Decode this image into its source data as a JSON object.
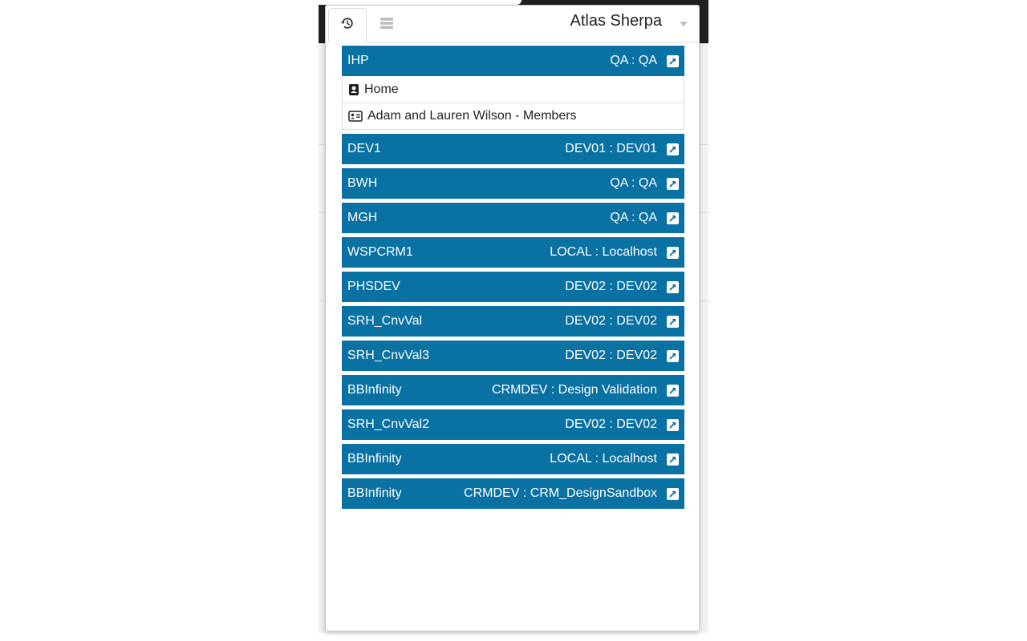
{
  "header": {
    "title": "Atlas Sherpa",
    "tabs": [
      {
        "icon": "history-icon",
        "active": true
      },
      {
        "icon": "server-icon",
        "active": false
      }
    ]
  },
  "colors": {
    "env_bar": "#0a71a3",
    "text_light": "#ffffff"
  },
  "environments": [
    {
      "name": "IHP",
      "target": "QA : QA",
      "items": [
        {
          "icon": "contact-book-icon",
          "label": "Home"
        },
        {
          "icon": "id-card-icon",
          "label": "Adam and Lauren Wilson - Members"
        }
      ]
    },
    {
      "name": "DEV1",
      "target": "DEV01 : DEV01"
    },
    {
      "name": "BWH",
      "target": "QA : QA"
    },
    {
      "name": "MGH",
      "target": "QA : QA"
    },
    {
      "name": "WSPCRM1",
      "target": "LOCAL : Localhost"
    },
    {
      "name": "PHSDEV",
      "target": "DEV02 : DEV02"
    },
    {
      "name": "SRH_CnvVal",
      "target": "DEV02 : DEV02"
    },
    {
      "name": "SRH_CnvVal3",
      "target": "DEV02 : DEV02"
    },
    {
      "name": "BBInfinity",
      "target": "CRMDEV : Design Validation"
    },
    {
      "name": "SRH_CnvVal2",
      "target": "DEV02 : DEV02"
    },
    {
      "name": "BBInfinity",
      "target": "LOCAL : Localhost"
    },
    {
      "name": "BBInfinity",
      "target": "CRMDEV : CRM_DesignSandbox"
    }
  ]
}
